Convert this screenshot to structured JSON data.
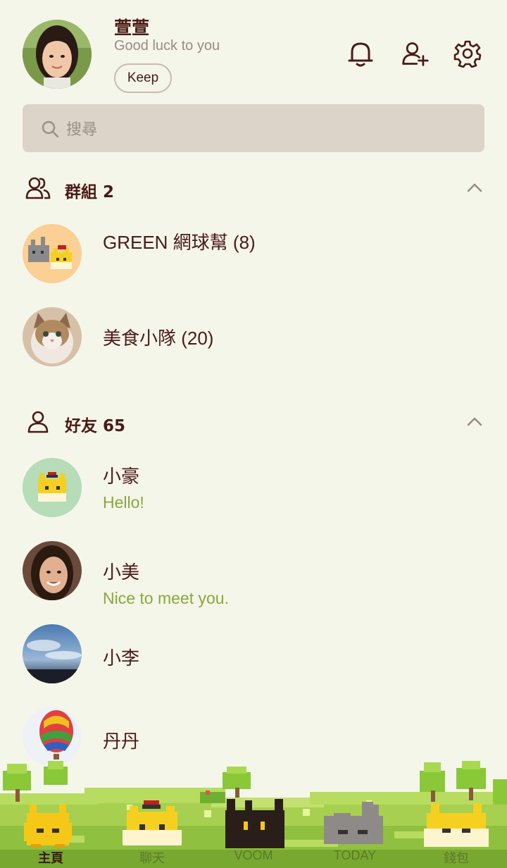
{
  "profile": {
    "name": "萱萱",
    "status": "Good luck to you",
    "keep_label": "Keep"
  },
  "header_icons": [
    "bell-icon",
    "add-friend-icon",
    "gear-icon"
  ],
  "search": {
    "placeholder": "搜尋"
  },
  "groups": {
    "title": "群組 2",
    "items": [
      {
        "name": "GREEN 網球幫 (8)"
      },
      {
        "name": "美食小隊 (20)"
      }
    ]
  },
  "friends": {
    "title": "好友 65",
    "items": [
      {
        "name": "小豪",
        "message": "Hello!"
      },
      {
        "name": "小美",
        "message": "Nice to meet you."
      },
      {
        "name": "小李",
        "message": ""
      },
      {
        "name": "丹丹",
        "message": ""
      }
    ]
  },
  "tabs": [
    {
      "label": "主頁",
      "active": true
    },
    {
      "label": "聊天",
      "active": false
    },
    {
      "label": "VOOM",
      "active": false
    },
    {
      "label": "TODAY",
      "active": false
    },
    {
      "label": "錢包",
      "active": false
    }
  ],
  "colors": {
    "background": "#f5f6ea",
    "text": "#4a1a14",
    "accent_green": "#8aa83a",
    "search_bg": "#dcd4c8"
  }
}
